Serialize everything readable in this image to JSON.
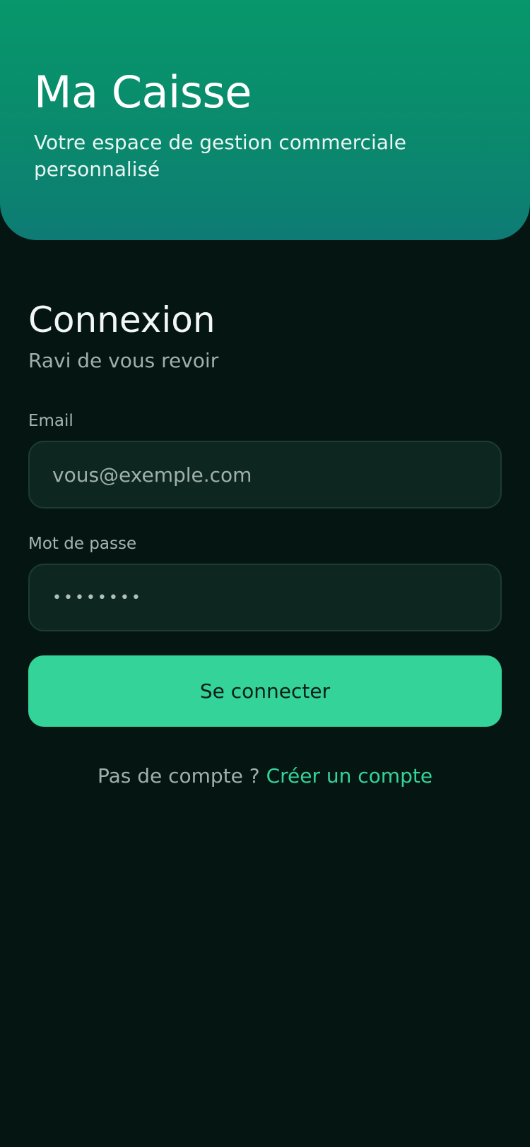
{
  "header": {
    "title": "Ma Caisse",
    "subtitle": "Votre espace de gestion commerciale personnalisé"
  },
  "login": {
    "title": "Connexion",
    "subtitle": "Ravi de vous revoir",
    "email": {
      "label": "Email",
      "placeholder": "vous@exemple.com",
      "value": ""
    },
    "password": {
      "label": "Mot de passe",
      "value": "••••••••"
    },
    "submit_label": "Se connecter",
    "signup_prompt": "Pas de compte ?",
    "signup_link": "Créer un compte"
  },
  "colors": {
    "background": "#051612",
    "header_gradient_top": "#07976b",
    "header_gradient_bottom": "#0e7b74",
    "accent": "#34d399",
    "field_background": "#0d2720",
    "field_border": "#1b3b33"
  }
}
